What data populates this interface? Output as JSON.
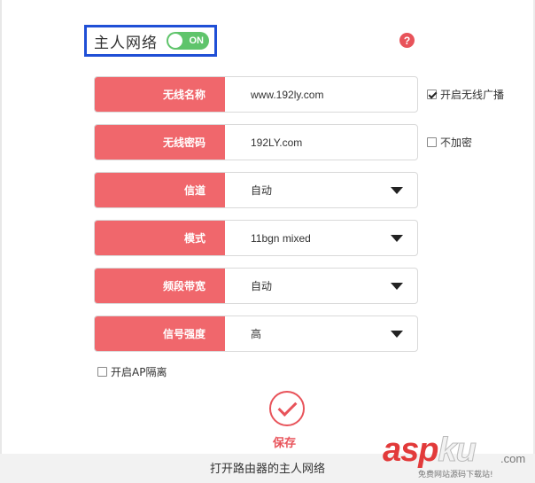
{
  "header": {
    "title": "主人网络",
    "toggle_label": "ON",
    "help_icon": "?"
  },
  "rows": [
    {
      "label": "无线名称",
      "value": "www.192ly.com",
      "dropdown": false
    },
    {
      "label": "无线密码",
      "value": "192LY.com",
      "dropdown": false
    },
    {
      "label": "信道",
      "value": "自动",
      "dropdown": true
    },
    {
      "label": "模式",
      "value": "11bgn mixed",
      "dropdown": true
    },
    {
      "label": "频段带宽",
      "value": "自动",
      "dropdown": true
    },
    {
      "label": "信号强度",
      "value": "高",
      "dropdown": true
    }
  ],
  "options": {
    "broadcast_label": "开启无线广播",
    "broadcast_checked": true,
    "no_encrypt_label": "不加密",
    "no_encrypt_checked": false,
    "ap_isolation_label": "开启AP隔离",
    "ap_isolation_checked": false
  },
  "save_label": "保存",
  "caption": "打开路由器的主人网络",
  "watermark": {
    "brand_a": "asp",
    "brand_b": "ku",
    "suffix": ".com",
    "tagline": "免费网站源码下载站!"
  },
  "colors": {
    "accent": "#f0676c",
    "highlight_box": "#1f4fd6",
    "toggle_on": "#5fc46b"
  }
}
